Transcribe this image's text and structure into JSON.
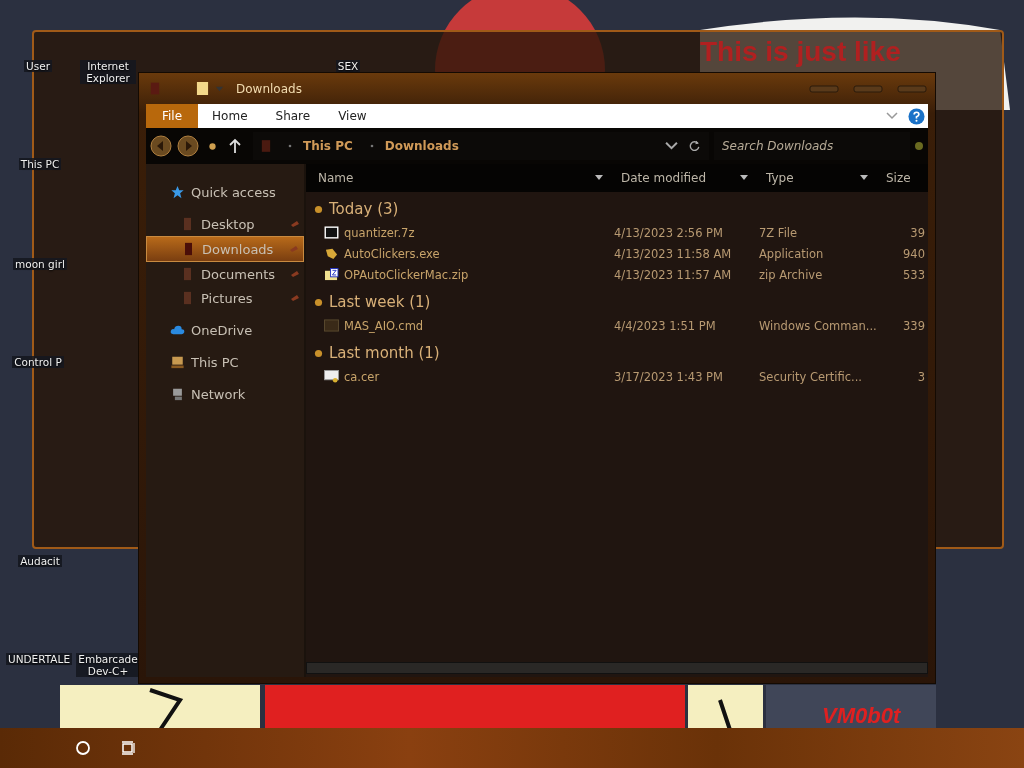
{
  "desktop": {
    "icons": [
      {
        "label": "User"
      },
      {
        "label": "Internet Explorer"
      },
      {
        "label": "SEX"
      },
      {
        "label": "This PC"
      },
      {
        "label": "moon girl"
      },
      {
        "label": "Control P"
      },
      {
        "label": "Audacit"
      },
      {
        "label": "UNDERTALE"
      },
      {
        "label": "Embarcade Dev-C+"
      }
    ],
    "banner": "This is just like",
    "corner_text": "VM0b0t"
  },
  "explorer": {
    "title": "Downloads",
    "ribbon_tabs": [
      {
        "label": "File",
        "selected": true
      },
      {
        "label": "Home",
        "selected": false
      },
      {
        "label": "Share",
        "selected": false
      },
      {
        "label": "View",
        "selected": false
      }
    ],
    "breadcrumbs": [
      "This PC",
      "Downloads"
    ],
    "search": {
      "placeholder": "Search Downloads"
    },
    "nav": [
      {
        "label": "Quick access",
        "kind": "star",
        "selected": false,
        "children": [
          {
            "label": "Desktop",
            "kind": "folder",
            "selected": false
          },
          {
            "label": "Downloads",
            "kind": "folder",
            "selected": true
          },
          {
            "label": "Documents",
            "kind": "folder",
            "selected": false
          },
          {
            "label": "Pictures",
            "kind": "folder",
            "selected": false
          }
        ]
      },
      {
        "label": "OneDrive",
        "kind": "cloud",
        "selected": false
      },
      {
        "label": "This PC",
        "kind": "pc",
        "selected": false
      },
      {
        "label": "Network",
        "kind": "network",
        "selected": false
      }
    ],
    "columns": [
      "Name",
      "Date modified",
      "Type",
      "Size"
    ],
    "groups": [
      {
        "title": "Today (3)",
        "files": [
          {
            "name": "quantizer.7z",
            "kind": "archive7z",
            "date": "4/13/2023 2:56 PM",
            "type": "7Z File",
            "size": "39"
          },
          {
            "name": "AutoClickers.exe",
            "kind": "app",
            "date": "4/13/2023 11:58 AM",
            "type": "Application",
            "size": "940"
          },
          {
            "name": "OPAutoClickerMac.zip",
            "kind": "zip",
            "date": "4/13/2023 11:57 AM",
            "type": "zip Archive",
            "size": "533"
          }
        ]
      },
      {
        "title": "Last week (1)",
        "files": [
          {
            "name": "MAS_AIO.cmd",
            "kind": "cmd",
            "date": "4/4/2023 1:51 PM",
            "type": "Windows Comman...",
            "size": "339"
          }
        ]
      },
      {
        "title": "Last month (1)",
        "files": [
          {
            "name": "ca.cer",
            "kind": "cert",
            "date": "3/17/2023 1:43 PM",
            "type": "Security Certific...",
            "size": "3"
          }
        ]
      }
    ]
  }
}
